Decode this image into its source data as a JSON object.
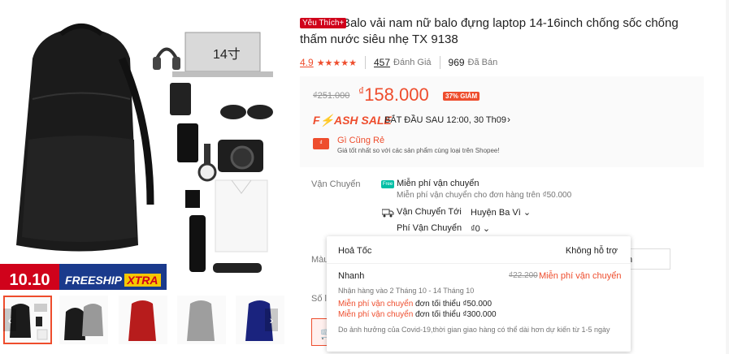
{
  "product": {
    "badge": "Yêu Thích+",
    "title": "Balo vải nam nữ balo đựng laptop 14-16inch chống sốc chống thấm nước siêu nhẹ TX 9138",
    "image_label": "14寸",
    "promo_banner": {
      "left": "10.10",
      "freeship": "FREESHIP",
      "xtra": "XTRA"
    }
  },
  "rating": {
    "score": "4.9",
    "stars": "★★★★★",
    "reviews_count": "457",
    "reviews_label": "Đánh Giá",
    "sold_count": "969",
    "sold_label": "Đã Bán"
  },
  "price": {
    "original": "₫251.000",
    "currency": "₫",
    "current": "158.000",
    "discount": "37% GIẢM",
    "flash_sale": "F⚡ASH SALE",
    "flash_time": "BẮT ĐẦU SAU 12:00, 30 Th09",
    "flash_chevron": "›",
    "guarantee_icon": "₫",
    "guarantee_title": "Gì Cũng Rẻ",
    "guarantee_sub": "Giá tốt nhất so với các sản phẩm cùng loại trên Shopee!"
  },
  "shipping": {
    "label": "Vận Chuyển",
    "free_icon": "Free",
    "free_title": "Miễn phí vận chuyển",
    "free_sub": "Miễn phí vận chuyển cho đơn hàng trên ₫50.000",
    "to_label": "Vận Chuyển Tới",
    "to_value": "Huyện Ba Vì ⌄",
    "fee_label": "Phí Vận Chuyển",
    "fee_value": "₫0 ⌄"
  },
  "side_labels": {
    "color": "Màu",
    "quantity": "Số l"
  },
  "size_option": "n",
  "buy_icon": "🛒",
  "popup": {
    "header_left": "Hoả Tốc",
    "header_right": "Không hỗ trợ",
    "option_name": "Nhanh",
    "old_fee": "₫22.200",
    "free_text": "Miễn phí vận chuyển",
    "estimate": "Nhận hàng vào 2 Tháng 10 - 14 Tháng 10",
    "lines": [
      {
        "red": "Miễn phí vận chuyển",
        "rest": " đơn tối thiểu ₫50.000"
      },
      {
        "red": "Miễn phí vận chuyển",
        "rest": " đơn tối thiểu ₫300.000"
      }
    ],
    "note": "Do ảnh hưởng của Covid-19,thời gian giao hàng có thể dài hơn dự kiến từ 1-5 ngày"
  },
  "colors": {
    "accent": "#ee4d2d",
    "badge": "#d0011b",
    "free_ship": "#00bfa5"
  }
}
